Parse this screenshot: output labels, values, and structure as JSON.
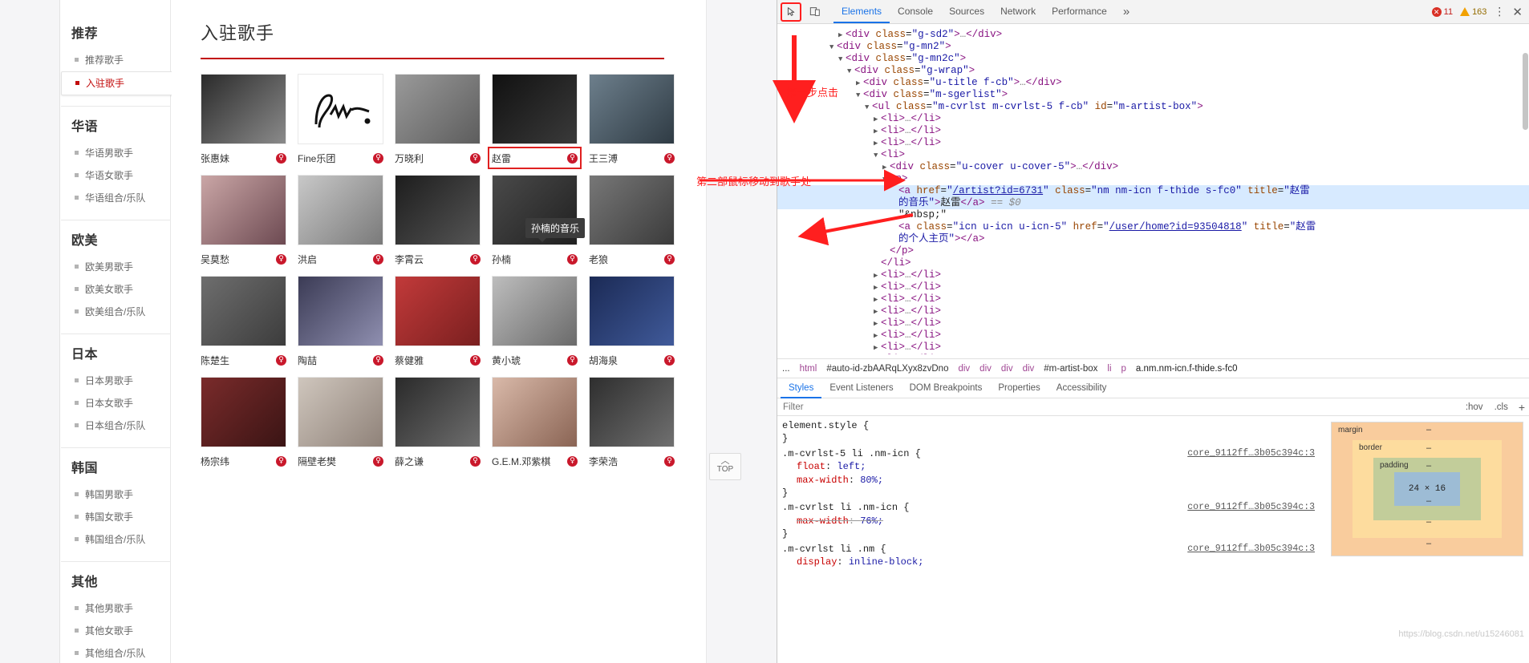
{
  "sidebar": {
    "groups": [
      {
        "title": "推荐",
        "items": [
          {
            "label": "推荐歌手",
            "active": false
          },
          {
            "label": "入驻歌手",
            "active": true
          }
        ]
      },
      {
        "title": "华语",
        "items": [
          {
            "label": "华语男歌手",
            "active": false
          },
          {
            "label": "华语女歌手",
            "active": false
          },
          {
            "label": "华语组合/乐队",
            "active": false
          }
        ]
      },
      {
        "title": "欧美",
        "items": [
          {
            "label": "欧美男歌手",
            "active": false
          },
          {
            "label": "欧美女歌手",
            "active": false
          },
          {
            "label": "欧美组合/乐队",
            "active": false
          }
        ]
      },
      {
        "title": "日本",
        "items": [
          {
            "label": "日本男歌手",
            "active": false
          },
          {
            "label": "日本女歌手",
            "active": false
          },
          {
            "label": "日本组合/乐队",
            "active": false
          }
        ]
      },
      {
        "title": "韩国",
        "items": [
          {
            "label": "韩国男歌手",
            "active": false
          },
          {
            "label": "韩国女歌手",
            "active": false
          },
          {
            "label": "韩国组合/乐队",
            "active": false
          }
        ]
      },
      {
        "title": "其他",
        "items": [
          {
            "label": "其他男歌手",
            "active": false
          },
          {
            "label": "其他女歌手",
            "active": false
          },
          {
            "label": "其他组合/乐队",
            "active": false
          }
        ]
      }
    ]
  },
  "main": {
    "title": "入驻歌手",
    "artist_icon_glyph": "♀",
    "tooltip": "孙楠的音乐",
    "top_button": {
      "caret": "︿",
      "label": "TOP"
    },
    "rows": [
      [
        {
          "name": "张惠妹"
        },
        {
          "name": "Fine乐团"
        },
        {
          "name": "万晓利"
        },
        {
          "name": "赵雷",
          "highlight": true
        },
        {
          "name": "王三溥"
        }
      ],
      [
        {
          "name": "吴莫愁"
        },
        {
          "name": "洪启"
        },
        {
          "name": "李霄云"
        },
        {
          "name": "孙楠"
        },
        {
          "name": "老狼"
        }
      ],
      [
        {
          "name": "陈楚生"
        },
        {
          "name": "陶喆"
        },
        {
          "name": "蔡健雅"
        },
        {
          "name": "黄小琥"
        },
        {
          "name": "胡海泉"
        }
      ],
      [
        {
          "name": "杨宗纬"
        },
        {
          "name": "隔壁老樊"
        },
        {
          "name": "薛之谦"
        },
        {
          "name": "G.E.M.邓紫棋"
        },
        {
          "name": "李荣浩"
        }
      ]
    ]
  },
  "annotations": {
    "step1": "第一步点击",
    "step2": "第二部鼠标移动到歌手处"
  },
  "devtools": {
    "toolbar": {
      "inspect_icon": "inspect-icon",
      "device_icon": "device-toggle-icon",
      "tabs": [
        {
          "label": "Elements",
          "active": true
        },
        {
          "label": "Console",
          "active": false
        },
        {
          "label": "Sources",
          "active": false
        },
        {
          "label": "Network",
          "active": false
        },
        {
          "label": "Performance",
          "active": false
        }
      ],
      "more": "»",
      "error_count": "11",
      "warning_count": "163",
      "kebab": "⋮",
      "close": "✕"
    },
    "dom_lines": [
      {
        "indent": 6,
        "twisty": "▶",
        "html": "<span class='tag'>&lt;div</span> <span class='attr'>class</span>=<span class='val'>\"g-sd2\"</span><span class='tag'>&gt;</span><span class='dots'>…</span><span class='tag'>&lt;/div&gt;</span>"
      },
      {
        "indent": 5,
        "twisty": "▼",
        "html": "<span class='tag'>&lt;div</span> <span class='attr'>class</span>=<span class='val'>\"g-mn2\"</span><span class='tag'>&gt;</span>"
      },
      {
        "indent": 6,
        "twisty": "▼",
        "html": "<span class='tag'>&lt;div</span> <span class='attr'>class</span>=<span class='val'>\"g-mn2c\"</span><span class='tag'>&gt;</span>"
      },
      {
        "indent": 7,
        "twisty": "▼",
        "html": "<span class='tag'>&lt;div</span> <span class='attr'>class</span>=<span class='val'>\"g-wrap\"</span><span class='tag'>&gt;</span>"
      },
      {
        "indent": 8,
        "twisty": "▶",
        "html": "<span class='tag'>&lt;div</span> <span class='attr'>class</span>=<span class='val'>\"u-title f-cb\"</span><span class='tag'>&gt;</span><span class='dots'>…</span><span class='tag'>&lt;/div&gt;</span>"
      },
      {
        "indent": 8,
        "twisty": "▼",
        "html": "<span class='tag'>&lt;div</span> <span class='attr'>class</span>=<span class='val'>\"m-sgerlist\"</span><span class='tag'>&gt;</span>"
      },
      {
        "indent": 9,
        "twisty": "▼",
        "html": "<span class='tag'>&lt;ul</span> <span class='attr'>class</span>=<span class='val'>\"m-cvrlst m-cvrlst-5 f-cb\"</span> <span class='attr'>id</span>=<span class='val'>\"m-artist-box\"</span><span class='tag'>&gt;</span>"
      },
      {
        "indent": 10,
        "twisty": "▶",
        "html": "<span class='tag'>&lt;li&gt;</span><span class='dots'>…</span><span class='tag'>&lt;/li&gt;</span>"
      },
      {
        "indent": 10,
        "twisty": "▶",
        "html": "<span class='tag'>&lt;li&gt;</span><span class='dots'>…</span><span class='tag'>&lt;/li&gt;</span>"
      },
      {
        "indent": 10,
        "twisty": "▶",
        "html": "<span class='tag'>&lt;li&gt;</span><span class='dots'>…</span><span class='tag'>&lt;/li&gt;</span>"
      },
      {
        "indent": 10,
        "twisty": "▼",
        "html": "<span class='tag'>&lt;li&gt;</span>"
      },
      {
        "indent": 11,
        "twisty": "▶",
        "html": "<span class='tag'>&lt;div</span> <span class='attr'>class</span>=<span class='val'>\"u-cover u-cover-5\"</span><span class='tag'>&gt;</span><span class='dots'>…</span><span class='tag'>&lt;/div&gt;</span>"
      },
      {
        "indent": 11,
        "twisty": "▼",
        "html": "<span class='tag'>&lt;p&gt;</span>"
      },
      {
        "indent": 12,
        "twisty": "",
        "selected": true,
        "html": "<span class='tag'>&lt;a</span> <span class='attr'>href</span>=<span class='val'>\"</span><span class='alnk'>/artist?id=6731</span><span class='val'>\"</span> <span class='attr'>class</span>=<span class='val'>\"nm nm-icn f-thide s-fc0\"</span> <span class='attr'>title</span>=<span class='val'>\"赵雷</span>"
      },
      {
        "indent": 12,
        "twisty": "",
        "selected": true,
        "html": "<span class='val'>的音乐\"</span><span class='tag'>&gt;</span><span class='txt'>赵雷</span><span class='tag'>&lt;/a&gt;</span> <span class='gray'>== $0</span>"
      },
      {
        "indent": 12,
        "twisty": "",
        "html": "<span class='txt'>\"&amp;nbsp;\"</span>"
      },
      {
        "indent": 12,
        "twisty": "",
        "html": "<span class='tag'>&lt;a</span> <span class='attr'>class</span>=<span class='val'>\"icn u-icn u-icn-5\"</span> <span class='attr'>href</span>=<span class='val'>\"</span><span class='alnk'>/user/home?id=93504818</span><span class='val'>\"</span> <span class='attr'>title</span>=<span class='val'>\"赵雷</span>"
      },
      {
        "indent": 12,
        "twisty": "",
        "html": "<span class='val'>的个人主页\"</span><span class='tag'>&gt;&lt;/a&gt;</span>"
      },
      {
        "indent": 11,
        "twisty": "",
        "html": "<span class='tag'>&lt;/p&gt;</span>"
      },
      {
        "indent": 10,
        "twisty": "",
        "html": "<span class='tag'>&lt;/li&gt;</span>"
      },
      {
        "indent": 10,
        "twisty": "▶",
        "html": "<span class='tag'>&lt;li&gt;</span><span class='dots'>…</span><span class='tag'>&lt;/li&gt;</span>"
      },
      {
        "indent": 10,
        "twisty": "▶",
        "html": "<span class='tag'>&lt;li&gt;</span><span class='dots'>…</span><span class='tag'>&lt;/li&gt;</span>"
      },
      {
        "indent": 10,
        "twisty": "▶",
        "html": "<span class='tag'>&lt;li&gt;</span><span class='dots'>…</span><span class='tag'>&lt;/li&gt;</span>"
      },
      {
        "indent": 10,
        "twisty": "▶",
        "html": "<span class='tag'>&lt;li&gt;</span><span class='dots'>…</span><span class='tag'>&lt;/li&gt;</span>"
      },
      {
        "indent": 10,
        "twisty": "▶",
        "html": "<span class='tag'>&lt;li&gt;</span><span class='dots'>…</span><span class='tag'>&lt;/li&gt;</span>"
      },
      {
        "indent": 10,
        "twisty": "▶",
        "html": "<span class='tag'>&lt;li&gt;</span><span class='dots'>…</span><span class='tag'>&lt;/li&gt;</span>"
      },
      {
        "indent": 10,
        "twisty": "▶",
        "html": "<span class='tag'>&lt;li&gt;</span><span class='dots'>…</span><span class='tag'>&lt;/li&gt;</span>"
      },
      {
        "indent": 10,
        "twisty": "▶",
        "html": "<span class='tag'>&lt;li&gt;</span><span class='dots'>…</span><span class='tag'>&lt;/li&gt;</span>"
      },
      {
        "indent": 10,
        "twisty": "▶",
        "html": "<span class='tag'>&lt;li&gt;</span><span class='dots'>…</span><span class='tag'>&lt;/li&gt;</span>"
      }
    ],
    "breadcrumb": [
      "...",
      "html",
      "#auto-id-zbAARqLXyx8zvDno",
      "div",
      "div",
      "div",
      "div",
      "#m-artist-box",
      "li",
      "p",
      "a.nm.nm-icn.f-thide.s-fc0"
    ],
    "panel_tabs": [
      {
        "label": "Styles",
        "active": true
      },
      {
        "label": "Event Listeners",
        "active": false
      },
      {
        "label": "DOM Breakpoints",
        "active": false
      },
      {
        "label": "Properties",
        "active": false
      },
      {
        "label": "Accessibility",
        "active": false
      }
    ],
    "filter": {
      "placeholder": "Filter",
      "hov": ":hov",
      "cls": ".cls",
      "plus": "+"
    },
    "styles": [
      {
        "selector": "element.style {",
        "close": "}",
        "source": "",
        "decls": []
      },
      {
        "selector": ".m-cvrlst-5 li .nm-icn {",
        "close": "}",
        "source": "core_9112ff…3b05c394c:3",
        "decls": [
          {
            "prop": "float",
            "value": "left;",
            "struck": false
          },
          {
            "prop": "max-width",
            "value": "80%;",
            "struck": false
          }
        ]
      },
      {
        "selector": ".m-cvrlst li .nm-icn {",
        "close": "}",
        "source": "core_9112ff…3b05c394c:3",
        "decls": [
          {
            "prop": "max-width",
            "value": "76%;",
            "struck": true
          }
        ]
      },
      {
        "selector": ".m-cvrlst li .nm {",
        "close": "",
        "source": "core_9112ff…3b05c394c:3",
        "decls": [
          {
            "prop": "display",
            "value": "inline-block;",
            "struck": false
          }
        ]
      }
    ],
    "box_model": {
      "margin_label": "margin",
      "border_label": "border",
      "padding_label": "padding",
      "content": "24 × 16",
      "dash": "–"
    },
    "watermark": "https://blog.csdn.net/u15246081"
  }
}
